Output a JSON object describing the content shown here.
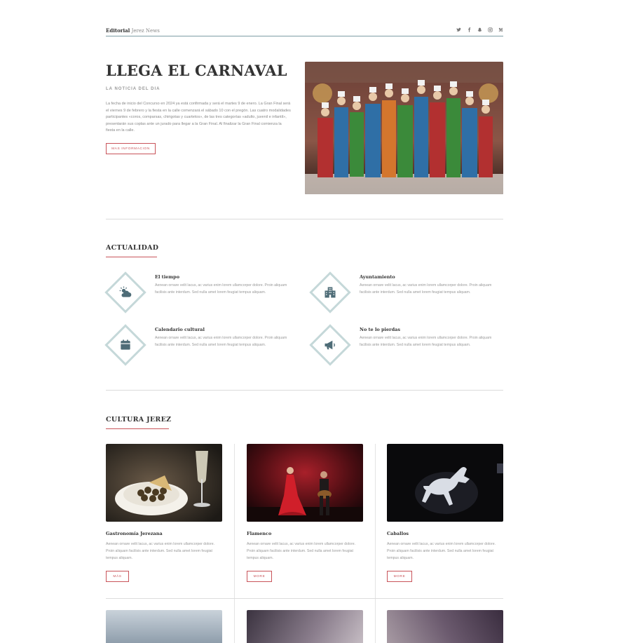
{
  "header": {
    "brand_strong": "Editorial",
    "brand_rest": "Jerez News",
    "social_icons": [
      "twitter-icon",
      "facebook-icon",
      "snapchat-icon",
      "instagram-icon",
      "medium-icon"
    ]
  },
  "hero": {
    "title": "LLEGA EL CARNAVAL",
    "subtitle": "LA NOTICIA DEL DIA",
    "body": "La fecha de inicio del Concurso en 2024 ya está confirmada y será el martes 9 de enero. La Gran Final será el viernes 9 de febrero y la fiesta en la calle comenzará el sábado 10 con el pregón. Las cuatro modalidades participantes «coros, comparsas, chirigotas y cuartetos», de las tres categorías «adulto, juvenil e infantil», presentarán sus coplas ante un jurado para llegar a la Gran Final. Al finalizar la Gran Final comienza la fiesta en la calle.",
    "button": "MAS INFORMACION"
  },
  "actualidad": {
    "title": "ACTUALIDAD",
    "items": [
      {
        "title": "El tiempo",
        "body": "Aenean ornare velit lacus, ac varius enim lorem ullamcorper dolore. Proin aliquam facilisis ante interdum. Sed nulla amet lorem feugiat tempus aliquam.",
        "icon": "weather-icon"
      },
      {
        "title": "Ayuntamiento",
        "body": "Aenean ornare velit lacus, ac varius enim lorem ullamcorper dolore. Proin aliquam facilisis ante interdum. Sed nulla amet lorem feugiat tempus aliquam.",
        "icon": "building-icon"
      },
      {
        "title": "Calendario cultural",
        "body": "Aenean ornare velit lacus, ac varius enim lorem ullamcorper dolore. Proin aliquam facilisis ante interdum. Sed nulla amet lorem feugiat tempus aliquam.",
        "icon": "calendar-icon"
      },
      {
        "title": "No te lo pierdas",
        "body": "Aenean ornare velit lacus, ac varius enim lorem ullamcorper dolore. Proin aliquam facilisis ante interdum. Sed nulla amet lorem feugiat tempus aliquam.",
        "icon": "megaphone-icon"
      }
    ]
  },
  "cultura": {
    "title": "CULTURA JEREZ",
    "cards": [
      {
        "title": "Gastronomía Jerezana",
        "body": "Aenean ornare velit lacus, ac varius enim lorem ullamcorper dolore. Proin aliquam facilisis ante interdum. Sed nulla amet lorem feugiat tempus aliquam.",
        "button": "MÁS"
      },
      {
        "title": "Flamenco",
        "body": "Aenean ornare velit lacus, ac varius enim lorem ullamcorper dolore. Proin aliquam facilisis ante interdum. Sed nulla amet lorem feugiat tempus aliquam.",
        "button": "MORE"
      },
      {
        "title": "Caballos",
        "body": "Aenean ornare velit lacus, ac varius enim lorem ullamcorper dolore. Proin aliquam facilisis ante interdum. Sed nulla amet lorem feugiat tempus aliquam.",
        "button": "MORE"
      }
    ]
  },
  "colors": {
    "accent": "#c9545a",
    "header_rule": "#7d9ca5",
    "icon_fill": "#4e6c77",
    "diamond_border": "#c5d8d9"
  }
}
